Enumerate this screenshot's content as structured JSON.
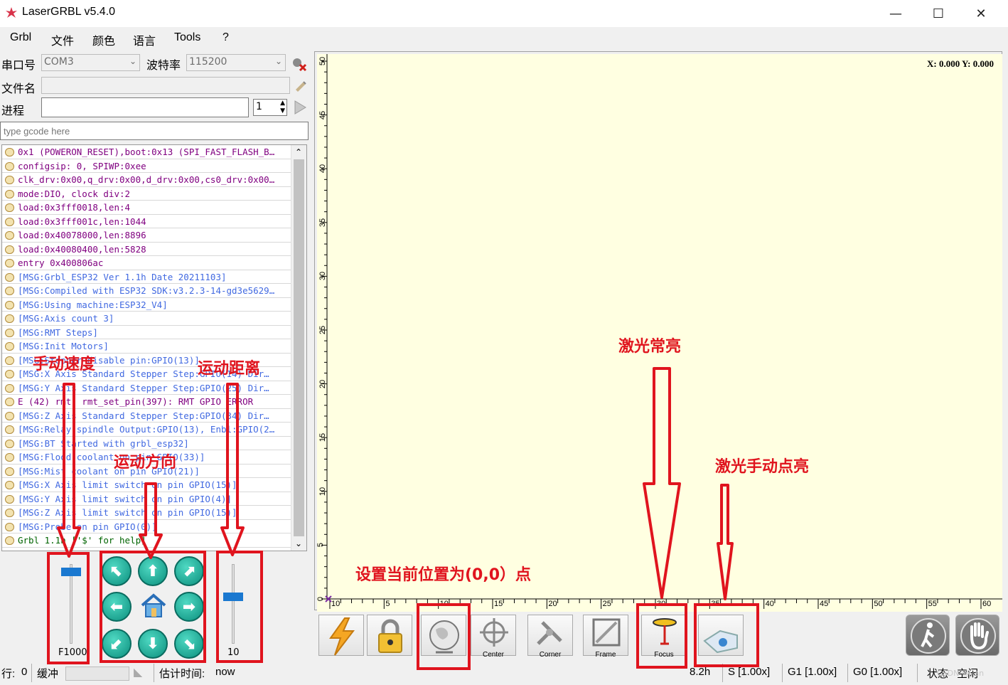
{
  "window": {
    "title": "LaserGRBL v5.4.0",
    "min_glyph": "—",
    "max_glyph": "☐",
    "close_glyph": "✕"
  },
  "menu": [
    "Grbl",
    "文件",
    "颜色",
    "语言",
    "Tools",
    "?"
  ],
  "connection": {
    "port_label": "串口号",
    "port_value": "COM3",
    "baud_label": "波特率",
    "baud_value": "115200",
    "file_label": "文件名",
    "file_value": "",
    "progress_label": "进程",
    "progress_count": "1",
    "gcode_placeholder": "type gcode here"
  },
  "log": [
    {
      "text": "0x1 (POWERON_RESET),boot:0x13 (SPI_FAST_FLASH_B…",
      "color": "#800080"
    },
    {
      "text": "configsip: 0, SPIWP:0xee",
      "color": "#800080"
    },
    {
      "text": "clk_drv:0x00,q_drv:0x00,d_drv:0x00,cs0_drv:0x00…",
      "color": "#800080"
    },
    {
      "text": "mode:DIO, clock div:2",
      "color": "#800080"
    },
    {
      "text": "load:0x3fff0018,len:4",
      "color": "#800080"
    },
    {
      "text": "load:0x3fff001c,len:1044",
      "color": "#800080"
    },
    {
      "text": "load:0x40078000,len:8896",
      "color": "#800080"
    },
    {
      "text": "load:0x40080400,len:5828",
      "color": "#800080"
    },
    {
      "text": "entry 0x400806ac",
      "color": "#800080"
    },
    {
      "text": "[MSG:Grbl_ESP32 Ver 1.1h Date 20211103]",
      "color": "#4169e1"
    },
    {
      "text": "[MSG:Compiled with ESP32 SDK:v3.2.3-14-gd3e5629…",
      "color": "#4169e1"
    },
    {
      "text": "[MSG:Using machine:ESP32_V4]",
      "color": "#4169e1"
    },
    {
      "text": "[MSG:Axis count 3]",
      "color": "#4169e1"
    },
    {
      "text": "[MSG:RMT Steps]",
      "color": "#4169e1"
    },
    {
      "text": "[MSG:Init Motors]",
      "color": "#4169e1"
    },
    {
      "text": "[MSG:Stepper disable pin:GPIO(13)]",
      "color": "#4169e1"
    },
    {
      "text": "[MSG:X  Axis Standard Stepper Step:GPIO(14) Dir…",
      "color": "#4169e1"
    },
    {
      "text": "[MSG:Y  Axis Standard Stepper Step:GPIO(25) Dir…",
      "color": "#4169e1"
    },
    {
      "text": "E (42) rmt: rmt_set_pin(397): RMT GPIO ERROR",
      "color": "#800080"
    },
    {
      "text": "[MSG:Z  Axis Standard Stepper Step:GPIO(34) Dir…",
      "color": "#4169e1"
    },
    {
      "text": "[MSG:Relay spindle Output:GPIO(13), Enbl:GPIO(2…",
      "color": "#4169e1"
    },
    {
      "text": "[MSG:BT Started with grbl_esp32]",
      "color": "#4169e1"
    },
    {
      "text": "[MSG:Flood coolant on pin GPIO(33)]",
      "color": "#4169e1"
    },
    {
      "text": "[MSG:Mist coolant on pin GPIO(21)]",
      "color": "#4169e1"
    },
    {
      "text": "[MSG:X  Axis limit switch on pin GPIO(15)]",
      "color": "#4169e1"
    },
    {
      "text": "[MSG:Y  Axis limit switch on pin GPIO(4)]",
      "color": "#4169e1"
    },
    {
      "text": "[MSG:Z  Axis limit switch on pin GPIO(15)]",
      "color": "#4169e1"
    },
    {
      "text": "[MSG:Probe on pin GPIO(0)]",
      "color": "#4169e1"
    },
    {
      "text": "Grbl 1.1h ['$' for help]",
      "color": "#006400"
    }
  ],
  "jog": {
    "speed_label": "F1000",
    "speed_level": 0.95,
    "step_label": "10",
    "step_level": 0.6,
    "arrows": {
      "nw": "⬉",
      "n": "⬆",
      "ne": "⬈",
      "w": "⬅",
      "e": "➡",
      "sw": "⬋",
      "s": "⬇",
      "se": "⬊",
      "home": "⌂"
    }
  },
  "canvas": {
    "coords": "X: 0.000 Y: 0.000",
    "y_ticks": [
      "50",
      "45",
      "40",
      "35",
      "30",
      "25",
      "20",
      "15",
      "10",
      "5",
      "0"
    ],
    "x_ticks": [
      "10",
      "5",
      "10",
      "15",
      "20",
      "25",
      "30",
      "35",
      "40",
      "45",
      "50",
      "55",
      "60"
    ]
  },
  "toolbar": {
    "center": "Center",
    "corner": "Corner",
    "frame": "Frame",
    "focus": "Focus"
  },
  "annotations": {
    "speed": "手动速度",
    "distance": "运动距离",
    "direction": "运动方向",
    "set_origin": "设置当前位置为(0,0）点",
    "laser_on": "激光常亮",
    "laser_manual": "激光手动点亮"
  },
  "status": {
    "line_label": "行:",
    "line_value": "0",
    "buffer_label": "缓冲",
    "eta_label": "估计时间:",
    "eta_value": "now",
    "s_override": "8.2h",
    "s_box": "S [1.00x]",
    "g1": "G1 [1.00x]",
    "g0": "G0 [1.00x]",
    "state_label": "状态",
    "state_value": "空闲",
    "watermark": "CSDN @yan"
  },
  "colors": {
    "annotation": "#e0141e",
    "canvas_bg": "#ffffe1"
  }
}
